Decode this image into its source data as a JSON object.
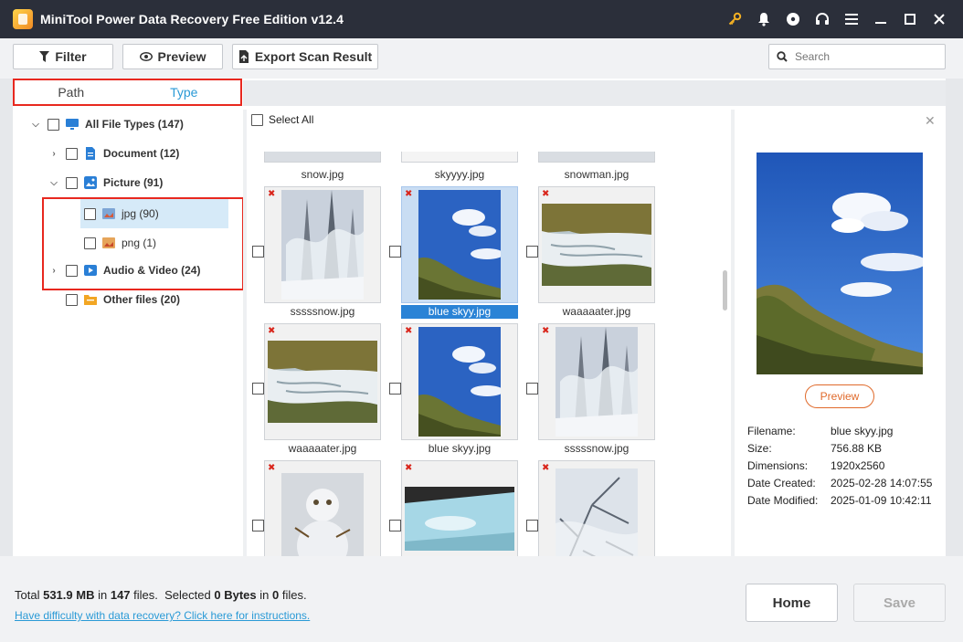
{
  "titlebar": {
    "title": "MiniTool Power Data Recovery Free Edition v12.4",
    "icons": [
      "key-icon",
      "bell-icon",
      "disc-icon",
      "headset-icon",
      "menu-icon",
      "minimize-icon",
      "maximize-icon",
      "close-icon"
    ]
  },
  "toolbar": {
    "filter_label": "Filter",
    "preview_label": "Preview",
    "export_label": "Export Scan Result",
    "search_placeholder": "Search"
  },
  "tabs": {
    "path_label": "Path",
    "type_label": "Type",
    "active": "Type"
  },
  "tree": {
    "all": "All File Types (147)",
    "document": "Document (12)",
    "picture": "Picture (91)",
    "jpg": "jpg (90)",
    "png": "png (1)",
    "audio_video": "Audio & Video (24)",
    "other": "Other files (20)"
  },
  "grid": {
    "select_all": "Select All",
    "top_row": [
      "snow.jpg",
      "skyyyy.jpg",
      "snowman.jpg"
    ],
    "items": [
      {
        "name": "sssssnow.jpg",
        "kind": "snowtree",
        "selected": false
      },
      {
        "name": "blue skyy.jpg",
        "kind": "sky",
        "selected": true
      },
      {
        "name": "waaaaater.jpg",
        "kind": "river",
        "selected": false
      },
      {
        "name": "waaaaater.jpg",
        "kind": "river",
        "selected": false
      },
      {
        "name": "blue skyy.jpg",
        "kind": "sky",
        "selected": false
      },
      {
        "name": "sssssnow.jpg",
        "kind": "snowtree",
        "selected": false
      },
      {
        "name": "",
        "kind": "snowman",
        "selected": false
      },
      {
        "name": "",
        "kind": "window",
        "selected": false
      },
      {
        "name": "",
        "kind": "branches",
        "selected": false
      }
    ]
  },
  "preview": {
    "button_label": "Preview",
    "filename_label": "Filename:",
    "filename": "blue skyy.jpg",
    "size_label": "Size:",
    "size": "756.88 KB",
    "dimensions_label": "Dimensions:",
    "dimensions": "1920x2560",
    "created_label": "Date Created:",
    "created": "2025-02-28 14:07:55",
    "modified_label": "Date Modified:",
    "modified": "2025-01-09 10:42:11"
  },
  "footer": {
    "total_prefix": "Total",
    "total_size": "531.9 MB",
    "in_word": "in",
    "total_files": "147",
    "files_word": "files.",
    "selected_prefix": "Selected",
    "selected_size": "0 Bytes",
    "selected_files": "0",
    "help_link": "Have difficulty with data recovery? Click here for instructions.",
    "home_label": "Home",
    "save_label": "Save"
  },
  "colors": {
    "titlebar": "#2b2f3a",
    "accent_blue": "#2a9ad6",
    "highlight_red": "#e8281f",
    "preview_orange": "#e06a2b"
  }
}
